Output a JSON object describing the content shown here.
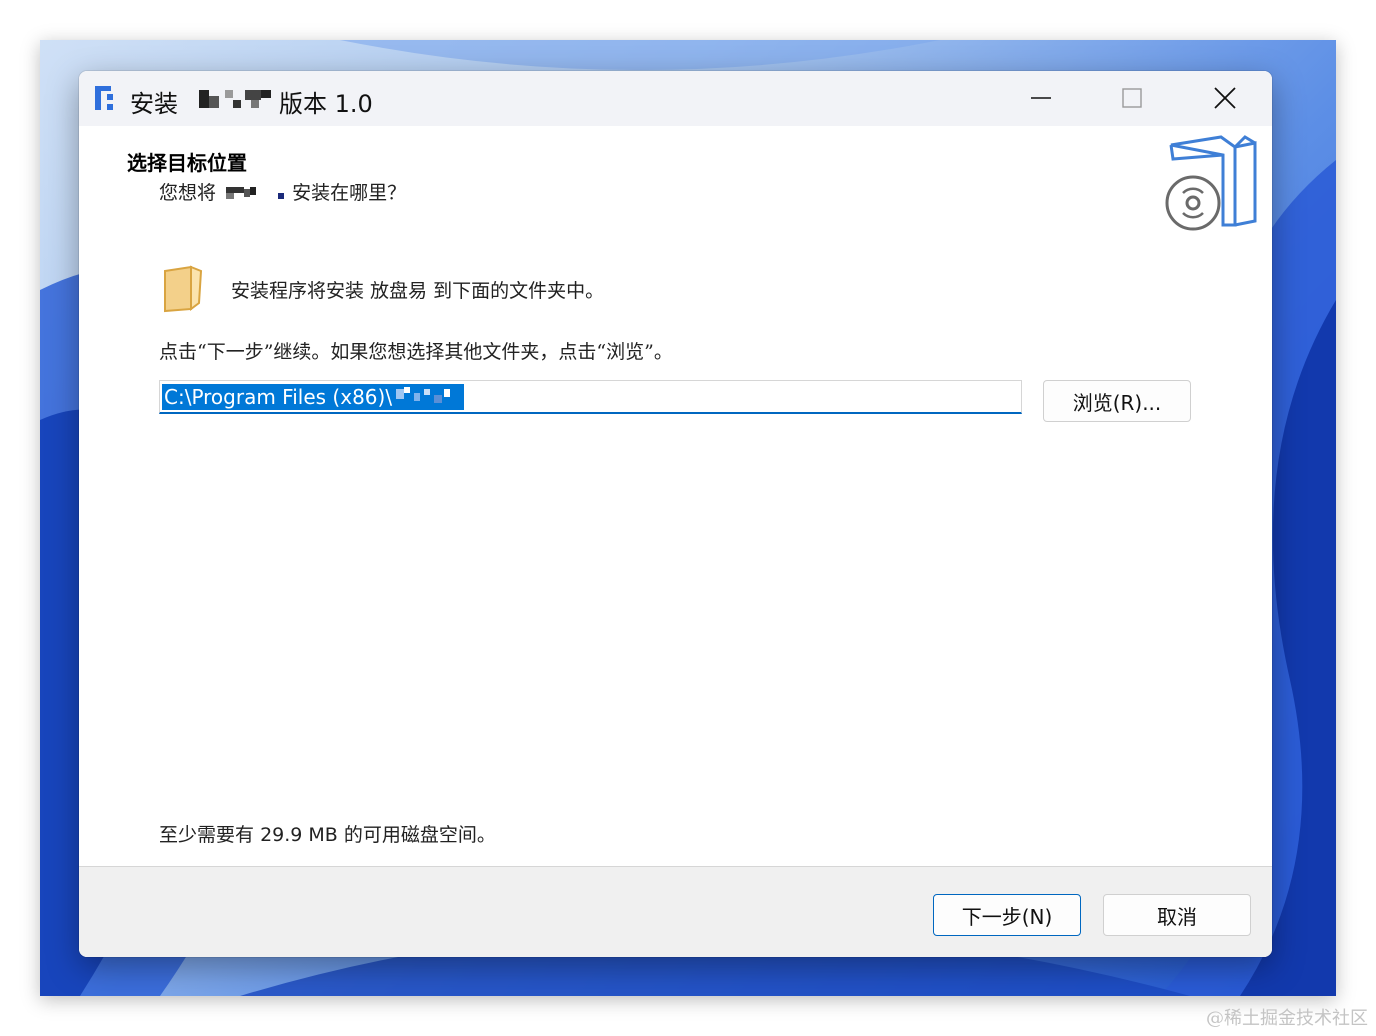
{
  "window": {
    "title_install": "安装",
    "title_version": "版本 1.0",
    "min_icon": "minimize-icon",
    "max_icon": "maximize-icon",
    "close_icon": "close-icon"
  },
  "header": {
    "title": "选择目标位置",
    "subtitle_prefix": "您想将",
    "subtitle_suffix": "安装在哪里？"
  },
  "body": {
    "info": "安装程序将安装 放盘易 到下面的文件夹中。",
    "hint": "点击“下一步”继续。如果您想选择其他文件夹，点击“浏览”。",
    "path_value": "C:\\Program Files (x86)\\",
    "browse_label": "浏览(R)...",
    "space_prefix": "至少需要有",
    "space_value": "29.9 MB",
    "space_suffix": "的可用磁盘空间。"
  },
  "footer": {
    "next_label": "下一步(N)",
    "cancel_label": "取消"
  },
  "watermark": "@稀土掘金技术社区",
  "colors": {
    "accent": "#0067c0",
    "selection": "#0078d7",
    "footer_bg": "#f0f0f0",
    "titlebar_bg": "#f2f3f7"
  }
}
